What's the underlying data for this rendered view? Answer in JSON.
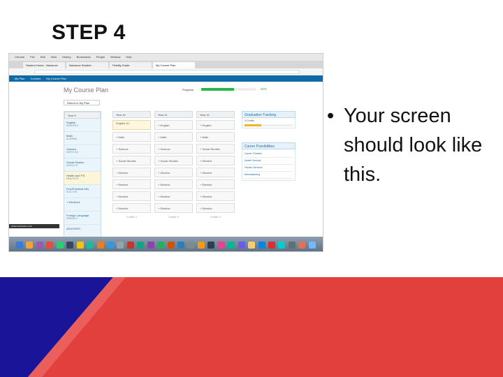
{
  "slide": {
    "title": "STEP 4",
    "bullet_symbol": "•",
    "bullet_text": "Your screen should look like this."
  },
  "screenshot": {
    "mac_menu": [
      "Chrome",
      "File",
      "Edit",
      "View",
      "History",
      "Bookmarks",
      "People",
      "Window",
      "Help"
    ],
    "browser_tabs": [
      "Student Home - Naviance",
      "Naviance Student",
      "Fidelity Guide",
      "My Course Plan"
    ],
    "nav_items": [
      "My Plan",
      "Courses",
      "My Course Plan"
    ],
    "page_heading": "My Course Plan",
    "progress_label": "Progress",
    "progress_percent": "60%",
    "progress_value": 0.6,
    "return_button": "Return to My Plan",
    "grade_column_title": "Year 9",
    "grade_items": [
      {
        "name": "English",
        "sub": "ENGLISH 9"
      },
      {
        "name": "Math",
        "sub": "ALGEBRA"
      },
      {
        "name": "Science",
        "sub": "EARTH SCI"
      },
      {
        "name": "Social Studies",
        "sub": "WORLD ST"
      },
      {
        "name": "Health and P.E.",
        "sub": "HEALTH PE"
      },
      {
        "name": "Fine/Practical Arts",
        "sub": "ELECTIVE"
      },
      {
        "name": "+ Electives",
        "sub": ""
      },
      {
        "name": "Foreign Language",
        "sub": "SPANISH 1"
      },
      {
        "name": "ADVISORY",
        "sub": ""
      }
    ],
    "year_columns": [
      {
        "title": "Year 10",
        "slots": [
          "English 10",
          "+ Math",
          "+ Science",
          "+ Social Studies",
          "+ Elective",
          "+ Elective",
          "+ Elective",
          "+ Elective"
        ],
        "foot": "Credits: 0"
      },
      {
        "title": "Year 11",
        "slots": [
          "+ English",
          "+ Math",
          "+ Science",
          "+ Social Studies",
          "+ Elective",
          "+ Elective",
          "+ Elective",
          "+ Elective"
        ],
        "foot": "Credits: 0"
      },
      {
        "title": "Year 12",
        "slots": [
          "+ English",
          "+ Math",
          "+ Social Studies",
          "+ Elective",
          "+ Elective",
          "+ Elective",
          "+ Elective",
          "+ Elective"
        ],
        "foot": "Credits: 0"
      }
    ],
    "side_panel": {
      "tracking_title": "Graduation Tracking",
      "tracking_line": "6 Credits",
      "tracking_value": 0.35,
      "possibilities_title": "Career Possibilities",
      "possibilities_items": [
        "Career Clusters",
        "Health Science",
        "Human Services",
        "Manufacturing"
      ]
    },
    "status_text": "www.naviance.com",
    "dock_colors": [
      "#3a7bd5",
      "#f2a33a",
      "#9b59b6",
      "#e74c3c",
      "#2ecc71",
      "#34495e",
      "#f1c40f",
      "#1abc9c",
      "#e67e22",
      "#3498db",
      "#95a5a6",
      "#c0392b",
      "#16a085",
      "#8e44ad",
      "#27ae60",
      "#d35400",
      "#2980b9",
      "#7f8c8d",
      "#f39c12",
      "#2c3e50",
      "#e84393",
      "#00b894",
      "#6c5ce7",
      "#fdcb6e",
      "#0984e3",
      "#d63031",
      "#00cec9",
      "#636e72",
      "#e17055",
      "#74b9ff"
    ]
  },
  "colors": {
    "band_blue": "#1a1499",
    "band_red": "#e2403d",
    "band_pink": "#f07875"
  }
}
